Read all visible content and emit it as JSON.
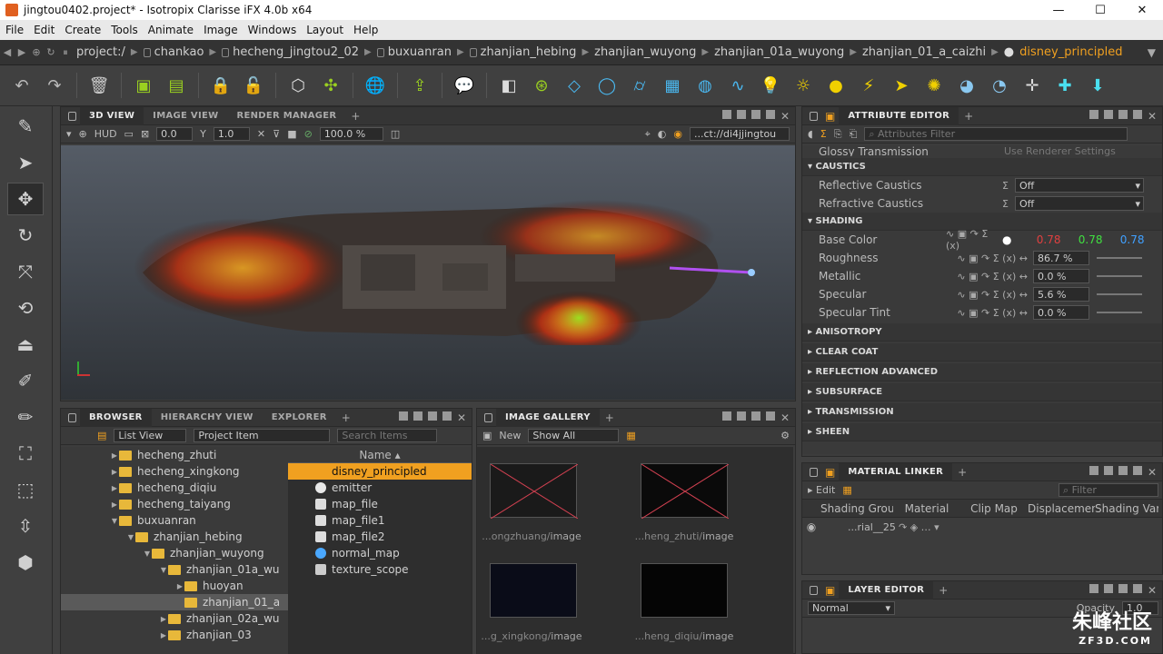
{
  "window": {
    "title": "jingtou0402.project* - Isotropix Clarisse iFX 4.0b x64",
    "min": "—",
    "max": "☐",
    "close": "✕"
  },
  "menu": [
    "File",
    "Edit",
    "Create",
    "Tools",
    "Animate",
    "Image",
    "Windows",
    "Layout",
    "Help"
  ],
  "path": {
    "crumbs": [
      "project:/",
      "chankao",
      "hecheng_jingtou2_02",
      "buxuanran",
      "zhanjian_hebing",
      "zhanjian_wuyong",
      "zhanjian_01a_wuyong",
      "zhanjian_01_a_caizhi"
    ],
    "active": "disney_principled"
  },
  "viewport": {
    "tabs": [
      "3D VIEW",
      "IMAGE VIEW",
      "RENDER MANAGER"
    ],
    "hud": "HUD",
    "v1": "0.0",
    "v2": "1.0",
    "pct": "100.0 %",
    "path": "...ct://di4jjingtou"
  },
  "browser": {
    "tabs": [
      "BROWSER",
      "HIERARCHY VIEW",
      "EXPLORER"
    ],
    "view_mode": "List View",
    "project_item": "Project Item",
    "search_placeholder": "Search Items",
    "name_header": "Name",
    "tree": [
      {
        "label": "hecheng_zhuti",
        "indent": 0,
        "arrow": "▶",
        "sel": false
      },
      {
        "label": "hecheng_xingkong",
        "indent": 0,
        "arrow": "▶",
        "sel": false
      },
      {
        "label": "hecheng_diqiu",
        "indent": 0,
        "arrow": "▶",
        "sel": false
      },
      {
        "label": "hecheng_taiyang",
        "indent": 0,
        "arrow": "▶",
        "sel": false
      },
      {
        "label": "buxuanran",
        "indent": 0,
        "arrow": "▼",
        "sel": false
      },
      {
        "label": "zhanjian_hebing",
        "indent": 1,
        "arrow": "▼",
        "sel": false
      },
      {
        "label": "zhanjian_wuyong",
        "indent": 2,
        "arrow": "▼",
        "sel": false
      },
      {
        "label": "zhanjian_01a_wu",
        "indent": 3,
        "arrow": "▼",
        "sel": false
      },
      {
        "label": "huoyan",
        "indent": 4,
        "arrow": "▶",
        "sel": false
      },
      {
        "label": "zhanjian_01_a",
        "indent": 4,
        "arrow": "",
        "sel": true
      },
      {
        "label": "zhanjian_02a_wu",
        "indent": 3,
        "arrow": "▶",
        "sel": false
      },
      {
        "label": "zhanjian_03",
        "indent": 3,
        "arrow": "▶",
        "sel": false
      }
    ],
    "items": [
      {
        "label": "disney_principled",
        "color": "#f0a020",
        "sel": true
      },
      {
        "label": "emitter",
        "color": "#e8e8e8",
        "sel": false
      },
      {
        "label": "map_file",
        "color": "#dddddd",
        "sel": false
      },
      {
        "label": "map_file1",
        "color": "#dddddd",
        "sel": false
      },
      {
        "label": "map_file2",
        "color": "#dddddd",
        "sel": false
      },
      {
        "label": "normal_map",
        "color": "#4aa8ff",
        "sel": false
      },
      {
        "label": "texture_scope",
        "color": "#cccccc",
        "sel": false
      }
    ]
  },
  "gallery": {
    "tab": "IMAGE GALLERY",
    "new": "New",
    "show": "Show All",
    "captions": [
      {
        "dim": "...ongzhuang/",
        "bold": "image"
      },
      {
        "dim": "...heng_zhuti/",
        "bold": "image"
      },
      {
        "dim": "...g_xingkong/",
        "bold": "image"
      },
      {
        "dim": "...heng_diqiu/",
        "bold": "image"
      }
    ]
  },
  "attr": {
    "tab": "ATTRIBUTE EDITOR",
    "filter_placeholder": "Attributes Filter",
    "top_row": "Glossy Transmission Depth",
    "top_row_val": "Use Renderer Settings",
    "caustics": "CAUSTICS",
    "refl_caustics": "Reflective Caustics",
    "refr_caustics": "Refractive Caustics",
    "off": "Off",
    "shading": "SHADING",
    "base_color": "Base Color",
    "bc_r": "0.78",
    "bc_g": "0.78",
    "bc_b": "0.78",
    "rows": [
      {
        "name": "Roughness",
        "value": "86.7 %"
      },
      {
        "name": "Metallic",
        "value": "0.0 %"
      },
      {
        "name": "Specular",
        "value": "5.6 %"
      },
      {
        "name": "Specular Tint",
        "value": "0.0 %"
      }
    ],
    "sections": [
      "ANISOTROPY",
      "CLEAR COAT",
      "REFLECTION ADVANCED",
      "SUBSURFACE",
      "TRANSMISSION",
      "SHEEN"
    ]
  },
  "material_linker": {
    "tab": "MATERIAL LINKER",
    "edit": "Edit",
    "filter_placeholder": "Filter",
    "cols": [
      "Shading Group",
      "Material",
      "Clip Map",
      "Displacement",
      "Shading Variab"
    ],
    "row": "...rial__25"
  },
  "layer_editor": {
    "tab": "LAYER EDITOR",
    "mode": "Normal",
    "opacity_label": "Opacity",
    "opacity": "1.0"
  },
  "watermark": {
    "main": "朱峰社区",
    "sub": "ZF3D.COM"
  }
}
